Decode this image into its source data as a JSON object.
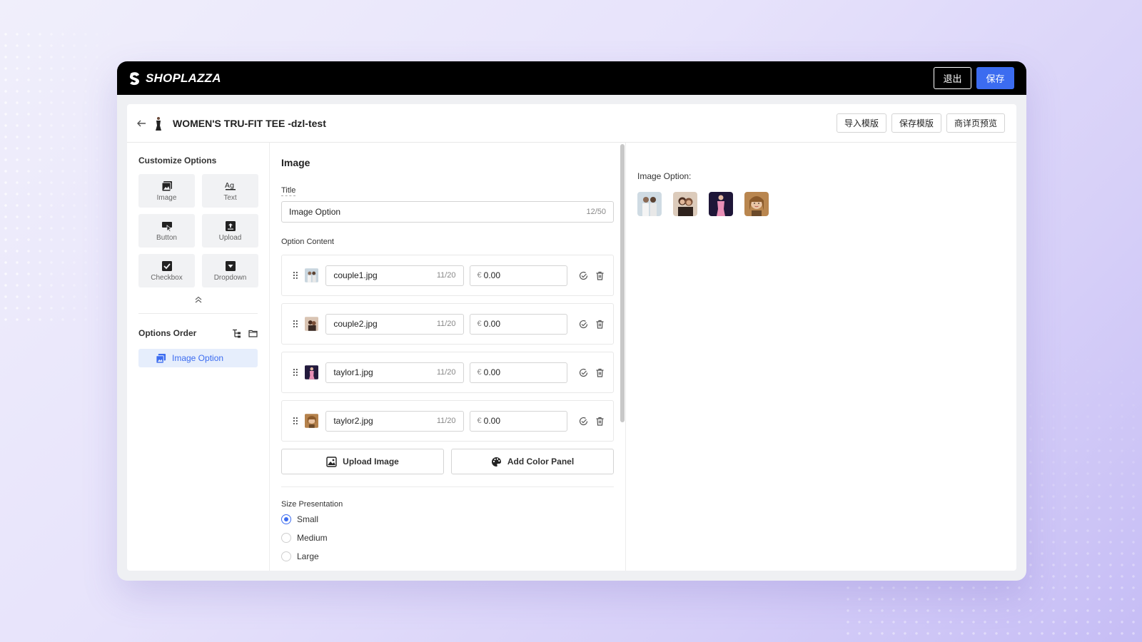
{
  "topbar": {
    "brand": "SHOPLAZZA",
    "exit_label": "退出",
    "save_label": "保存",
    "accent_color": "#3c6cf0"
  },
  "header": {
    "back_icon": "arrow-left-icon",
    "product_title": "WOMEN'S TRU-FIT TEE -dzl-test",
    "actions": [
      "导入模版",
      "保存模版",
      "商详页预览"
    ]
  },
  "sidebar": {
    "customize_title": "Customize Options",
    "options": [
      {
        "label": "Image",
        "icon": "image-icon"
      },
      {
        "label": "Text",
        "icon": "text-icon"
      },
      {
        "label": "Button",
        "icon": "button-cursor-icon"
      },
      {
        "label": "Upload",
        "icon": "upload-icon"
      },
      {
        "label": "Checkbox",
        "icon": "checkbox-icon"
      },
      {
        "label": "Dropdown",
        "icon": "dropdown-icon"
      }
    ],
    "order_title": "Options Order",
    "order_items": [
      {
        "label": "Image Option",
        "icon": "image-icon"
      }
    ]
  },
  "editor": {
    "heading": "Image",
    "title_label": "Title",
    "title_value": "Image Option",
    "title_counter": "12/50",
    "content_label": "Option Content",
    "rows": [
      {
        "name": "couple1.jpg",
        "counter": "11/20",
        "currency": "€",
        "price": "0.00"
      },
      {
        "name": "couple2.jpg",
        "counter": "11/20",
        "currency": "€",
        "price": "0.00"
      },
      {
        "name": "taylor1.jpg",
        "counter": "11/20",
        "currency": "€",
        "price": "0.00"
      },
      {
        "name": "taylor2.jpg",
        "counter": "11/20",
        "currency": "€",
        "price": "0.00"
      }
    ],
    "upload_label": "Upload Image",
    "color_panel_label": "Add Color Panel",
    "size_label": "Size Presentation",
    "sizes": [
      {
        "label": "Small",
        "selected": true
      },
      {
        "label": "Medium",
        "selected": false
      },
      {
        "label": "Large",
        "selected": false
      }
    ]
  },
  "preview": {
    "label": "Image Option:"
  }
}
